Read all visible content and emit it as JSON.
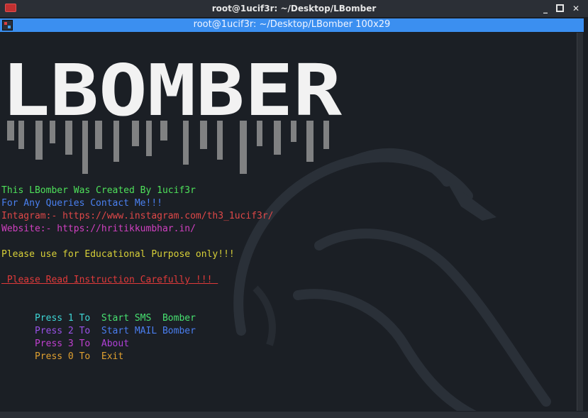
{
  "window": {
    "title": "root@1ucif3r: ~/Desktop/LBomber",
    "minimize_glyph": "_",
    "close_glyph": "✕"
  },
  "tab": {
    "title": "root@1ucif3r: ~/Desktop/LBomber 100x29"
  },
  "banner": {
    "text": "LBOMBER"
  },
  "lines": {
    "created_by": "This LBomber Was Created By 1ucif3r",
    "queries": "For Any Queries Contact Me!!!",
    "instagram": "Intagram:- https://www.instagram.com/th3_1ucif3r/",
    "website": "Website:- https://hritikkumbhar.in/",
    "educational": "Please use for Educational Purpose only!!!",
    "instruction": " Please Read Instruction Carefully !!! "
  },
  "menu": [
    {
      "press": "Press 1 To ",
      "action": " Start SMS  Bomber",
      "color": "#3ed6d6",
      "action_color": "#47e070"
    },
    {
      "press": "Press 2 To ",
      "action": " Start MAIL Bomber",
      "color": "#9a52e8",
      "action_color": "#4a7ef0"
    },
    {
      "press": "Press 3 To ",
      "action": " About",
      "color": "#c040d0",
      "action_color": "#b040d8"
    },
    {
      "press": "Press 0 To ",
      "action": " Exit",
      "color": "#e0a030",
      "action_color": "#e0a030"
    }
  ],
  "colors": {
    "created_by": "#4ee05a",
    "queries": "#4a80f0",
    "instagram": "#e04848",
    "website": "#d040c0",
    "educational": "#d8d038",
    "educational_accent": "#e89030",
    "instruction": "#e03a3a",
    "titlebar": "#2b2f36",
    "tabbar": "#3b8ff0",
    "terminal_bg": "#1b1f25"
  }
}
